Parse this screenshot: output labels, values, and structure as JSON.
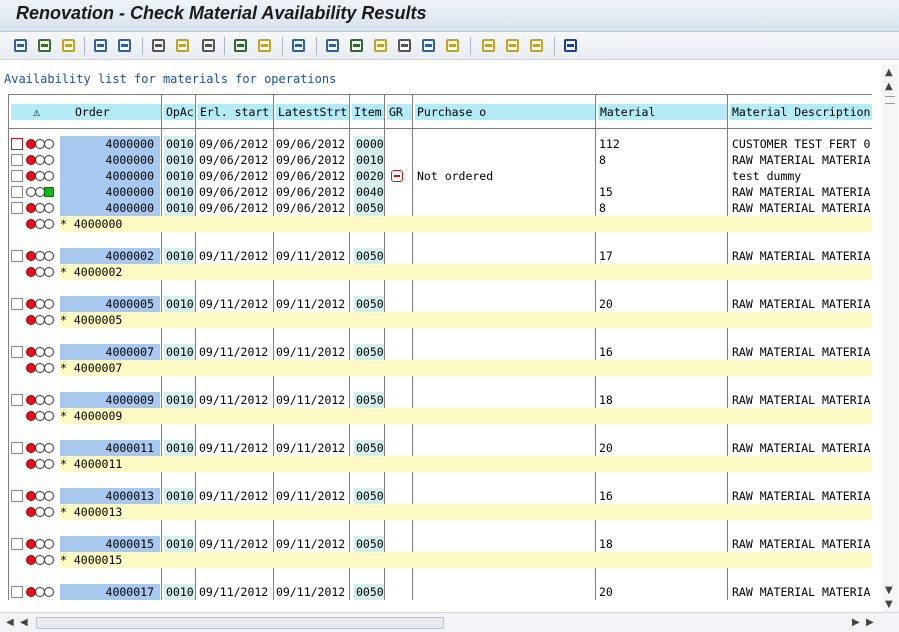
{
  "window": {
    "title": "Renovation - Check Material Availability Results"
  },
  "toolbar": {
    "icons": [
      "details-icon",
      "hierarchy-icon",
      "layout-icon",
      "doc-icon",
      "doc-edit-icon",
      "print-icon",
      "filter-icon",
      "filter-clear-icon",
      "sum-icon",
      "subtotal-icon",
      "export-icon",
      "spreadsheet-icon",
      "download-icon",
      "local-file-icon",
      "change-layout-icon",
      "mail-icon",
      "graphic-icon",
      "grid-icon",
      "grid-cols-icon",
      "grid-rows-icon",
      "info-icon"
    ]
  },
  "list": {
    "subtitle": "Availability list for materials for operations",
    "columns": [
      "⚠",
      "Order",
      "OpAc",
      "Erl. start",
      "LatestStrt",
      "Item",
      "GR",
      "Purchase o",
      "Material",
      "Material Description"
    ],
    "groups": [
      {
        "rows": [
          {
            "order": "4000000",
            "opac": "0010",
            "erl": "09/06/2012",
            "latest": "09/06/2012",
            "item": "0000",
            "purchase": "",
            "material": "112",
            "desc": "CUSTOMER TEST FERT 0",
            "status": "red"
          },
          {
            "order": "4000000",
            "opac": "0010",
            "erl": "09/06/2012",
            "latest": "09/06/2012",
            "item": "0010",
            "purchase": "",
            "material": "8",
            "desc": "RAW MATERIAL MATERIA",
            "status": "red"
          },
          {
            "order": "4000000",
            "opac": "0010",
            "erl": "09/06/2012",
            "latest": "09/06/2012",
            "item": "0020",
            "purchase": "Not ordered",
            "material": "",
            "desc": "test dummy",
            "status": "red",
            "gr": "not-ordered"
          },
          {
            "order": "4000000",
            "opac": "0010",
            "erl": "09/06/2012",
            "latest": "09/06/2012",
            "item": "0040",
            "purchase": "",
            "material": "15",
            "desc": "RAW MATERIAL MATERIA",
            "status": "green"
          },
          {
            "order": "4000000",
            "opac": "0010",
            "erl": "09/06/2012",
            "latest": "09/06/2012",
            "item": "0050",
            "purchase": "",
            "material": "8",
            "desc": "RAW MATERIAL MATERIA",
            "status": "red"
          }
        ],
        "total": "* 4000000"
      },
      {
        "rows": [
          {
            "order": "4000002",
            "opac": "0010",
            "erl": "09/11/2012",
            "latest": "09/11/2012",
            "item": "0050",
            "purchase": "",
            "material": "17",
            "desc": "RAW MATERIAL MATERIA",
            "status": "red"
          }
        ],
        "total": "* 4000002"
      },
      {
        "rows": [
          {
            "order": "4000005",
            "opac": "0010",
            "erl": "09/11/2012",
            "latest": "09/11/2012",
            "item": "0050",
            "purchase": "",
            "material": "20",
            "desc": "RAW MATERIAL MATERIA",
            "status": "red"
          }
        ],
        "total": "* 4000005"
      },
      {
        "rows": [
          {
            "order": "4000007",
            "opac": "0010",
            "erl": "09/11/2012",
            "latest": "09/11/2012",
            "item": "0050",
            "purchase": "",
            "material": "16",
            "desc": "RAW MATERIAL MATERIA",
            "status": "red"
          }
        ],
        "total": "* 4000007"
      },
      {
        "rows": [
          {
            "order": "4000009",
            "opac": "0010",
            "erl": "09/11/2012",
            "latest": "09/11/2012",
            "item": "0050",
            "purchase": "",
            "material": "18",
            "desc": "RAW MATERIAL MATERIA",
            "status": "red"
          }
        ],
        "total": "* 4000009"
      },
      {
        "rows": [
          {
            "order": "4000011",
            "opac": "0010",
            "erl": "09/11/2012",
            "latest": "09/11/2012",
            "item": "0050",
            "purchase": "",
            "material": "20",
            "desc": "RAW MATERIAL MATERIA",
            "status": "red"
          }
        ],
        "total": "* 4000011"
      },
      {
        "rows": [
          {
            "order": "4000013",
            "opac": "0010",
            "erl": "09/11/2012",
            "latest": "09/11/2012",
            "item": "0050",
            "purchase": "",
            "material": "16",
            "desc": "RAW MATERIAL MATERIA",
            "status": "red"
          }
        ],
        "total": "* 4000013"
      },
      {
        "rows": [
          {
            "order": "4000015",
            "opac": "0010",
            "erl": "09/11/2012",
            "latest": "09/11/2012",
            "item": "0050",
            "purchase": "",
            "material": "18",
            "desc": "RAW MATERIAL MATERIA",
            "status": "red"
          }
        ],
        "total": "* 4000015"
      },
      {
        "rows": [
          {
            "order": "4000017",
            "opac": "0010",
            "erl": "09/11/2012",
            "latest": "09/11/2012",
            "item": "0050",
            "purchase": "",
            "material": "20",
            "desc": "RAW MATERIAL MATERIA",
            "status": "red"
          }
        ],
        "total": null
      }
    ]
  },
  "colors": {
    "order_cell": "#a8c8ef",
    "header_cell": "#b3ecf6",
    "total_row": "#fff9c4",
    "light_red": "#e0141e",
    "light_green": "#1cb01c"
  }
}
